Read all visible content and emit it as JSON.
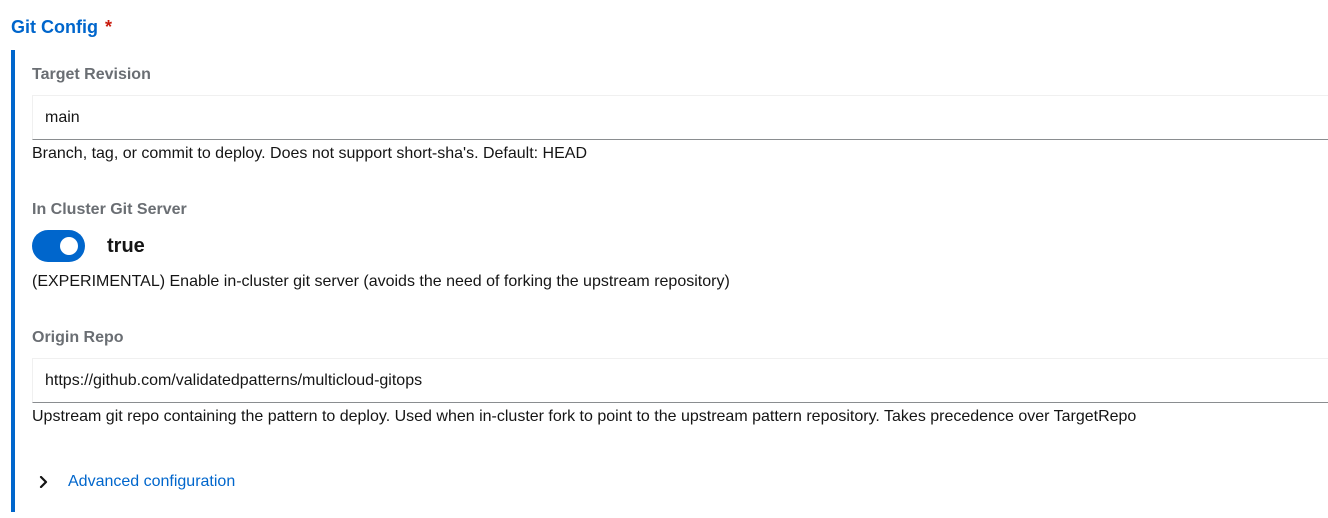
{
  "section": {
    "title": "Git Config",
    "required_marker": "*"
  },
  "target_revision": {
    "label": "Target Revision",
    "value": "main",
    "help": "Branch, tag, or commit to deploy. Does not support short-sha's. Default: HEAD"
  },
  "in_cluster_git_server": {
    "label": "In Cluster Git Server",
    "toggle_state": "true",
    "help": "(EXPERIMENTAL) Enable in-cluster git server (avoids the need of forking the upstream repository)"
  },
  "origin_repo": {
    "label": "Origin Repo",
    "value": "https://github.com/validatedpatterns/multicloud-gitops",
    "help": "Upstream git repo containing the pattern to deploy. Used when in-cluster fork to point to the upstream pattern repository. Takes precedence over TargetRepo"
  },
  "advanced": {
    "label": "Advanced configuration",
    "icon": "chevron-right-icon"
  },
  "colors": {
    "accent": "#0066cc",
    "required": "#c9190b",
    "label_gray": "#6a6e73"
  }
}
